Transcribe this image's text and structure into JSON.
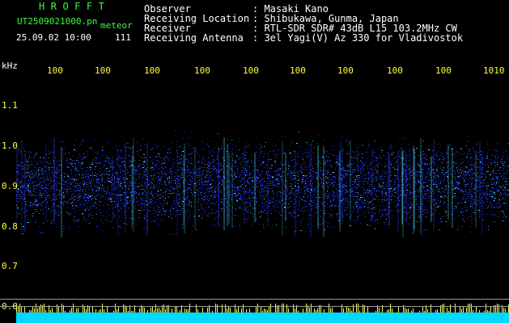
{
  "header": {
    "logo": "HROFFT",
    "filename": "UT2509021000.pn",
    "mode_label": "meteor",
    "datetime": "25.09.02 10:00",
    "count": "111"
  },
  "station": [
    {
      "label": "Observer",
      "value": ": Masaki Kano"
    },
    {
      "label": "Receiving Location",
      "value": ": Shibukawa, Gunma, Japan"
    },
    {
      "label": "Receiver",
      "value": ": RTL-SDR SDR# 43dB L15 103.2MHz CW"
    },
    {
      "label": "Receiving Antenna",
      "value": ": 3el Yagi(V) Az 330 for Vladivostok"
    }
  ],
  "yaxis": {
    "unit": "kHz",
    "ticks": [
      "1.1",
      "1.0",
      "0.9",
      "0.8",
      "0.7",
      "0.6"
    ]
  },
  "time_ticks": [
    "100",
    "100",
    "100",
    "100",
    "100",
    "100",
    "100",
    "100",
    "100",
    "1010"
  ],
  "colors": {
    "background": "#000000",
    "text_white": "#ffffff",
    "text_green": "#36ff36",
    "text_yellow": "#ffff40",
    "signal_blue": "#2a3cff",
    "signal_cyan": "#50e8ff",
    "bottom_bar": "#00d8ff"
  }
}
